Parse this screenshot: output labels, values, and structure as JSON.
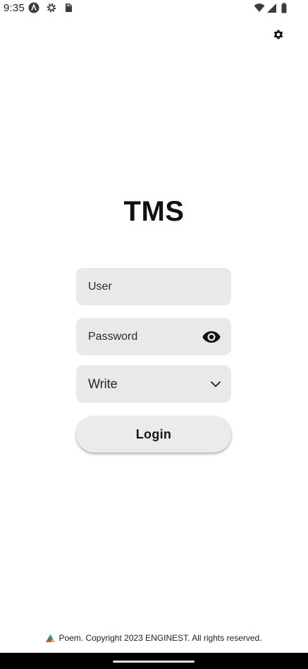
{
  "status_bar": {
    "time": "9:35",
    "left_icons": [
      "android-studio-icon",
      "gear-icon",
      "sd-card-icon"
    ],
    "right_icons": [
      "wifi-icon",
      "cell-signal-icon",
      "battery-icon"
    ]
  },
  "settings": {
    "icon": "gear-icon"
  },
  "app": {
    "title": "TMS"
  },
  "form": {
    "user_placeholder": "User",
    "password_placeholder": "Password",
    "password_toggle_icon": "eye-icon",
    "mode_select": {
      "selected": "Write",
      "icon": "chevron-down-icon"
    },
    "login_label": "Login"
  },
  "footer": {
    "logo_icon": "poem-logo-icon",
    "text": "Poem. Copyright 2023 ENGINEST. All rights reserved."
  },
  "colors": {
    "field_background": "#e9e9e9",
    "button_background": "#ebebeb",
    "text_primary": "#111111"
  }
}
